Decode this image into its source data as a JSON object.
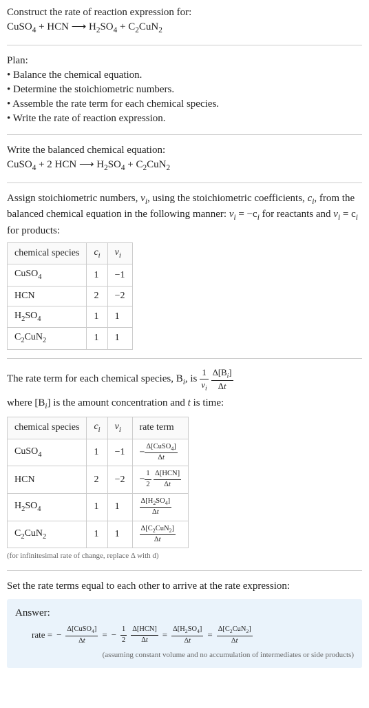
{
  "construct": {
    "title": "Construct the rate of reaction expression for:",
    "equation_lhs1": "CuSO",
    "equation_lhs2": " + HCN ",
    "arrow": "⟶",
    "equation_rhs1": " H",
    "equation_rhs2": "SO",
    "equation_rhs3": " + C",
    "equation_rhs4": "CuN"
  },
  "plan": {
    "title": "Plan:",
    "items": [
      "• Balance the chemical equation.",
      "• Determine the stoichiometric numbers.",
      "• Assemble the rate term for each chemical species.",
      "• Write the rate of reaction expression."
    ]
  },
  "balanced": {
    "title": "Write the balanced chemical equation:",
    "eq_a": "CuSO",
    "eq_b": " + 2 HCN ",
    "arrow": "⟶",
    "eq_c": " H",
    "eq_d": "SO",
    "eq_e": " + C",
    "eq_f": "CuN"
  },
  "assign": {
    "text_a": "Assign stoichiometric numbers, ",
    "v": "ν",
    "text_b": ", using the stoichiometric coefficients, ",
    "c": "c",
    "text_c": ", from the balanced chemical equation in the following manner: ",
    "rel1a": "ν",
    "rel1b": " = −c",
    "text_d": " for reactants and ",
    "rel2a": "ν",
    "rel2b": " = c",
    "text_e": " for products:"
  },
  "table1": {
    "headers": [
      "chemical species",
      "cᵢ",
      "νᵢ"
    ],
    "rows": [
      {
        "sp_a": "CuSO",
        "sp_b": "4",
        "c": "1",
        "v": "−1"
      },
      {
        "sp_a": "HCN",
        "sp_b": "",
        "c": "2",
        "v": "−2"
      },
      {
        "sp_a": "H",
        "sp_b": "2",
        "sp_c": "SO",
        "sp_d": "4",
        "c": "1",
        "v": "1"
      },
      {
        "sp_a": "C",
        "sp_b": "2",
        "sp_c": "CuN",
        "sp_d": "2",
        "c": "1",
        "v": "1"
      }
    ]
  },
  "rateterm": {
    "text_a": "The rate term for each chemical species, B",
    "text_b": ", is ",
    "one": "1",
    "nu": "ν",
    "dBi": "Δ[B",
    "dBi2": "]",
    "dt": "Δt",
    "text_c": " where [B",
    "text_d": "] is the amount concentration and ",
    "t": "t",
    "text_e": " is time:"
  },
  "table2": {
    "headers": [
      "chemical species",
      "cᵢ",
      "νᵢ",
      "rate term"
    ],
    "rows": [
      {
        "c": "1",
        "v": "−1"
      },
      {
        "c": "2",
        "v": "−2"
      },
      {
        "c": "1",
        "v": "1"
      },
      {
        "c": "1",
        "v": "1"
      }
    ]
  },
  "note": "(for infinitesimal rate of change, replace Δ with d)",
  "setequal": "Set the rate terms equal to each other to arrive at the rate expression:",
  "answer": {
    "label": "Answer:",
    "rate": "rate = ",
    "neg": "−",
    "half": "1",
    "half2": "2",
    "eq": "=",
    "assumption": "(assuming constant volume and no accumulation of intermediates or side products)"
  },
  "chart_data": {
    "type": "table",
    "title": "Stoichiometric numbers and rate terms",
    "stoichiometry": [
      {
        "species": "CuSO4",
        "c_i": 1,
        "nu_i": -1
      },
      {
        "species": "HCN",
        "c_i": 2,
        "nu_i": -2
      },
      {
        "species": "H2SO4",
        "c_i": 1,
        "nu_i": 1
      },
      {
        "species": "C2CuN2",
        "c_i": 1,
        "nu_i": 1
      }
    ],
    "rate_terms": [
      {
        "species": "CuSO4",
        "c_i": 1,
        "nu_i": -1,
        "rate_term": "-Δ[CuSO4]/Δt"
      },
      {
        "species": "HCN",
        "c_i": 2,
        "nu_i": -2,
        "rate_term": "-(1/2)Δ[HCN]/Δt"
      },
      {
        "species": "H2SO4",
        "c_i": 1,
        "nu_i": 1,
        "rate_term": "Δ[H2SO4]/Δt"
      },
      {
        "species": "C2CuN2",
        "c_i": 1,
        "nu_i": 1,
        "rate_term": "Δ[C2CuN2]/Δt"
      }
    ],
    "balanced_equation": "CuSO4 + 2 HCN ⟶ H2SO4 + C2CuN2",
    "rate_expression": "rate = -Δ[CuSO4]/Δt = -(1/2)Δ[HCN]/Δt = Δ[H2SO4]/Δt = Δ[C2CuN2]/Δt"
  }
}
